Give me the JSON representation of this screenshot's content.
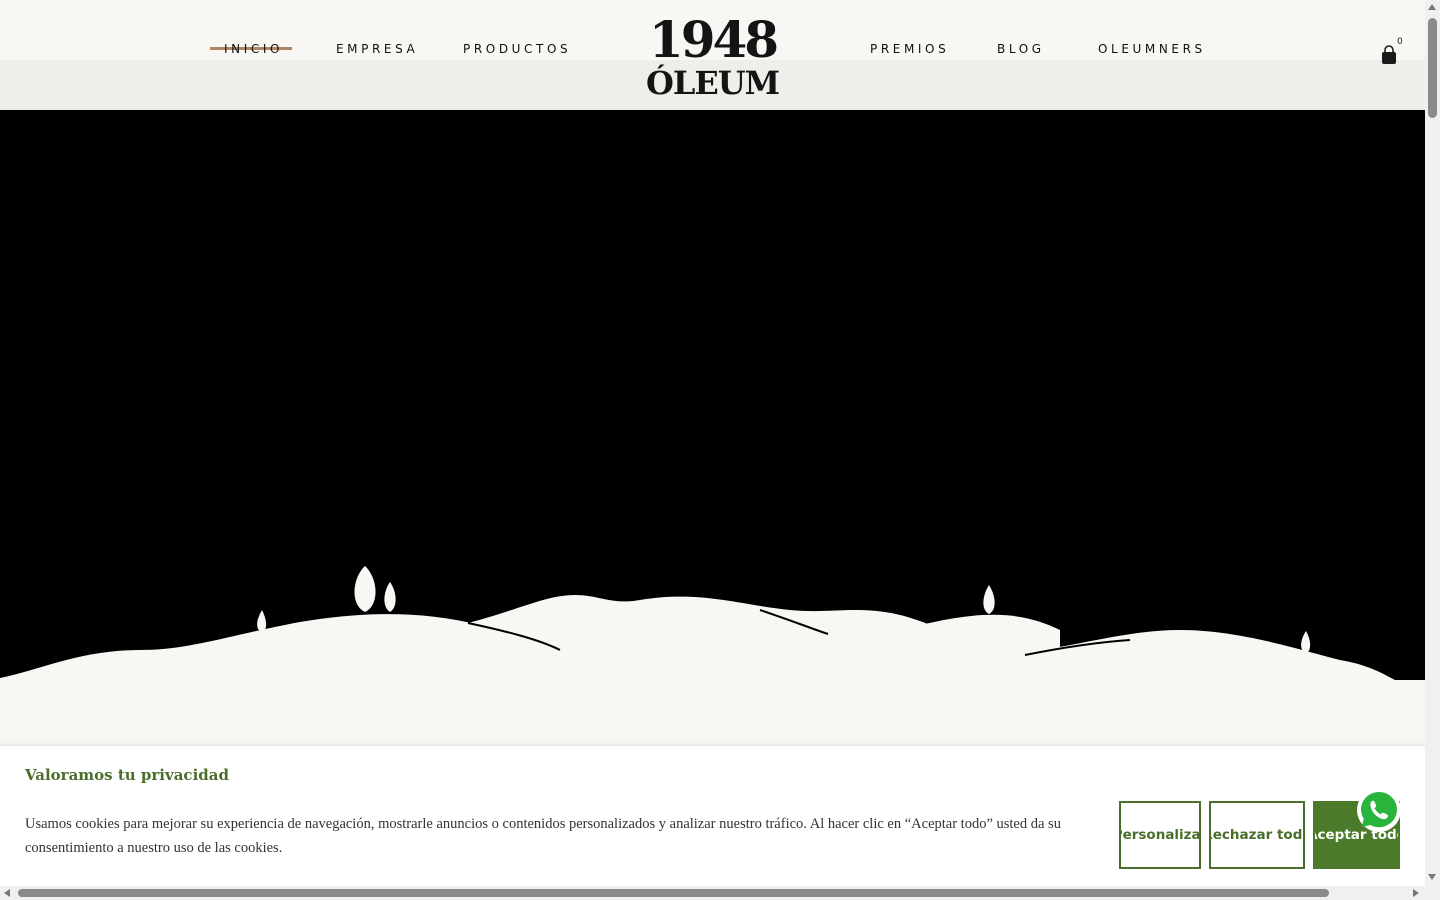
{
  "nav": {
    "left": [
      {
        "label": "INICIO",
        "active": true
      },
      {
        "label": "EMPRESA"
      },
      {
        "label": "PRODUCTOS"
      }
    ],
    "right": [
      {
        "label": "PREMIOS"
      },
      {
        "label": "BLOG"
      },
      {
        "label": "OLEUMNERS"
      }
    ]
  },
  "logo": {
    "line1": "1948",
    "line2": "ÓLEUM"
  },
  "cart": {
    "icon": "shopping-bag-icon",
    "count": "0"
  },
  "colors": {
    "accent": "#b08562",
    "green": "#4a7a2a",
    "cream": "#f8f7f3",
    "hero": "#000000"
  },
  "cookie": {
    "title": "Valoramos tu privacidad",
    "text": "Usamos cookies para mejorar su experiencia de navegación, mostrarle anuncios o contenidos personalizados y analizar nuestro tráfico. Al hacer clic en “Aceptar todo” usted da su consentimiento a nuestro uso de las cookies.",
    "customize_label": "Personalizar",
    "reject_label": "Rechazar todo",
    "accept_label": "Aceptar todo"
  },
  "whatsapp": {
    "icon": "whatsapp-icon"
  }
}
